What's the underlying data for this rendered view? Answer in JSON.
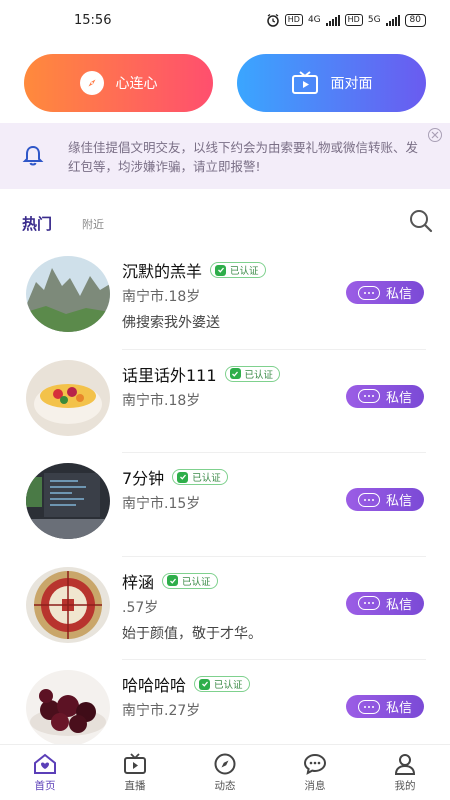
{
  "status_bar": {
    "time": "15:56",
    "hd1": "HD",
    "net1": "4G",
    "hd2": "HD",
    "net2": "5G",
    "battery": "80"
  },
  "top_buttons": {
    "heart_label": "心连心",
    "face_label": "面对面"
  },
  "notice": {
    "text": "缘佳佳提倡文明交友，以线下约会为由索要礼物或微信转账、发红包等，均涉嫌诈骗，请立即报警!"
  },
  "tabs": {
    "hot": "热门",
    "nearby": "附近"
  },
  "verified_label": "已认证",
  "message_label": "私信",
  "users": [
    {
      "name": "沉默的羔羊",
      "info": "南宁市.18岁",
      "bio": "佛搜索我外婆送"
    },
    {
      "name": "话里话外111",
      "info": "南宁市.18岁",
      "bio": ""
    },
    {
      "name": "7分钟",
      "info": "南宁市.15岁",
      "bio": ""
    },
    {
      "name": "梓涵",
      "info": ".57岁",
      "bio": "始于颜值，敬于才华。"
    },
    {
      "name": "哈哈哈哈",
      "info": "南宁市.27岁",
      "bio": ""
    }
  ],
  "bottom_nav": [
    {
      "label": "首页",
      "icon": "home-icon",
      "active": true
    },
    {
      "label": "直播",
      "icon": "tv-icon",
      "active": false
    },
    {
      "label": "动态",
      "icon": "compass-icon",
      "active": false
    },
    {
      "label": "消息",
      "icon": "chat-icon",
      "active": false
    },
    {
      "label": "我的",
      "icon": "user-icon",
      "active": false
    }
  ],
  "colors": {
    "accent": "#5b3fb8",
    "heart_gradient_start": "#ff8a3c",
    "heart_gradient_end": "#ff4f6e",
    "face_gradient_start": "#3aa6ff",
    "face_gradient_end": "#6a5bf0",
    "message_button": "#8e52e0",
    "notice_bg": "#f3edf9",
    "verified_green": "#2eae4a"
  }
}
